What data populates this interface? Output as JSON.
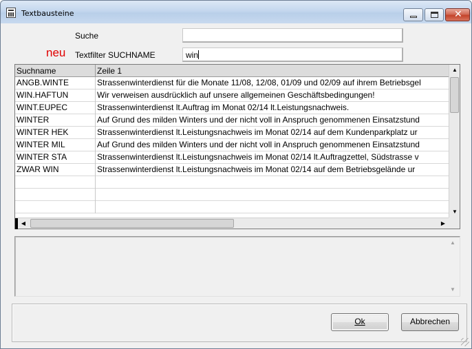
{
  "window": {
    "title": "Textbausteine"
  },
  "search": {
    "label": "Suche",
    "value": ""
  },
  "filter": {
    "badge": "neu",
    "badge_color": "#e00000",
    "label": "Textfilter SUCHNAME",
    "value": "win"
  },
  "grid": {
    "columns": [
      "Suchname",
      "Zeile 1"
    ],
    "rows": [
      [
        "ANGB.WINTE",
        "Strassenwinterdienst für die Monate 11/08, 12/08, 01/09 und 02/09 auf ihrem Betriebsgel"
      ],
      [
        "WIN.HAFTUN",
        "Wir verweisen ausdrücklich auf unsere allgemeinen Geschäftsbedingungen!"
      ],
      [
        "WINT.EUPEC",
        "Strassenwinterdienst lt.Auftrag im Monat 02/14 lt.Leistungsnachweis."
      ],
      [
        "WINTER",
        "Auf Grund des milden Winters und der nicht voll in Anspruch genommenen Einsatzstund"
      ],
      [
        "WINTER HEK",
        "Strassenwinterdienst lt.Leistungsnachweis im Monat 02/14 auf dem Kundenparkplatz ur"
      ],
      [
        "WINTER MIL",
        "Auf Grund des milden Winters und der nicht voll in Anspruch genommenen Einsatzstund"
      ],
      [
        "WINTER STA",
        "Strassenwinterdienst lt.Leistungsnachweis im Monat 02/14 lt.Auftragzettel, Südstrasse v"
      ],
      [
        "ZWAR WIN",
        "Strassenwinterdienst lt.Leistungsnachweis im Monat 02/14 auf dem Betriebsgelände ur"
      ],
      [
        "",
        ""
      ],
      [
        "",
        ""
      ],
      [
        "",
        ""
      ]
    ],
    "vscroll_position": 0.0,
    "hscroll_position": 0.0
  },
  "memo": {
    "value": ""
  },
  "buttons": {
    "ok": "Ok",
    "cancel": "Abbrechen"
  }
}
